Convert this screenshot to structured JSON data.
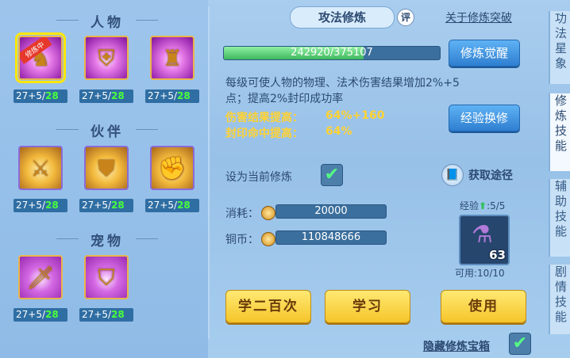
{
  "header": {
    "title": "攻法修炼",
    "eval_label": "评",
    "breakthrough_link": "关于修炼突破"
  },
  "left": {
    "sections": [
      {
        "title": "人物"
      },
      {
        "title": "伙伴"
      },
      {
        "title": "宠物"
      }
    ],
    "slot_level_prefix": "27+5/",
    "slot_level_suffix": "28",
    "selected_tag": "修炼中"
  },
  "progress": {
    "current": 242920,
    "max": 375107,
    "text": "242920/375107",
    "fill_fraction": 0.647
  },
  "awaken_button": "修炼觉醒",
  "exchange_button": "经验换修",
  "description": "每级可使人物的物理、法术伤害结果增加2%+5点；提高2%封印成功率",
  "stats": [
    {
      "label": "伤害结果提高：",
      "value": "64%+160"
    },
    {
      "label": "封印命中提高：",
      "value": "64%"
    }
  ],
  "set_current": {
    "label": "设为当前修炼",
    "checked": true
  },
  "obtain": {
    "label": "获取途径"
  },
  "cost": {
    "label": "消耗：",
    "value": "20000"
  },
  "copper": {
    "label": "铜币：",
    "value": "110848666"
  },
  "item": {
    "exp_label": "经验",
    "exp_value": ":5/5",
    "count": "63",
    "usable": "可用:10/10"
  },
  "buttons": {
    "learn200": "学二百次",
    "learn": "学习",
    "use": "使用"
  },
  "hide_box": {
    "label": "隐藏修炼宝箱",
    "checked": true
  },
  "side_tabs": [
    {
      "label": "功法星象"
    },
    {
      "label": "修炼技能"
    },
    {
      "label": "辅助技能"
    },
    {
      "label": "剧情技能"
    }
  ],
  "colors": {
    "accent_yellow": "#f5c52a",
    "progress_green": "#5dd07a",
    "text_dark": "#2c4a72",
    "stat_yellow": "#ffd233"
  }
}
